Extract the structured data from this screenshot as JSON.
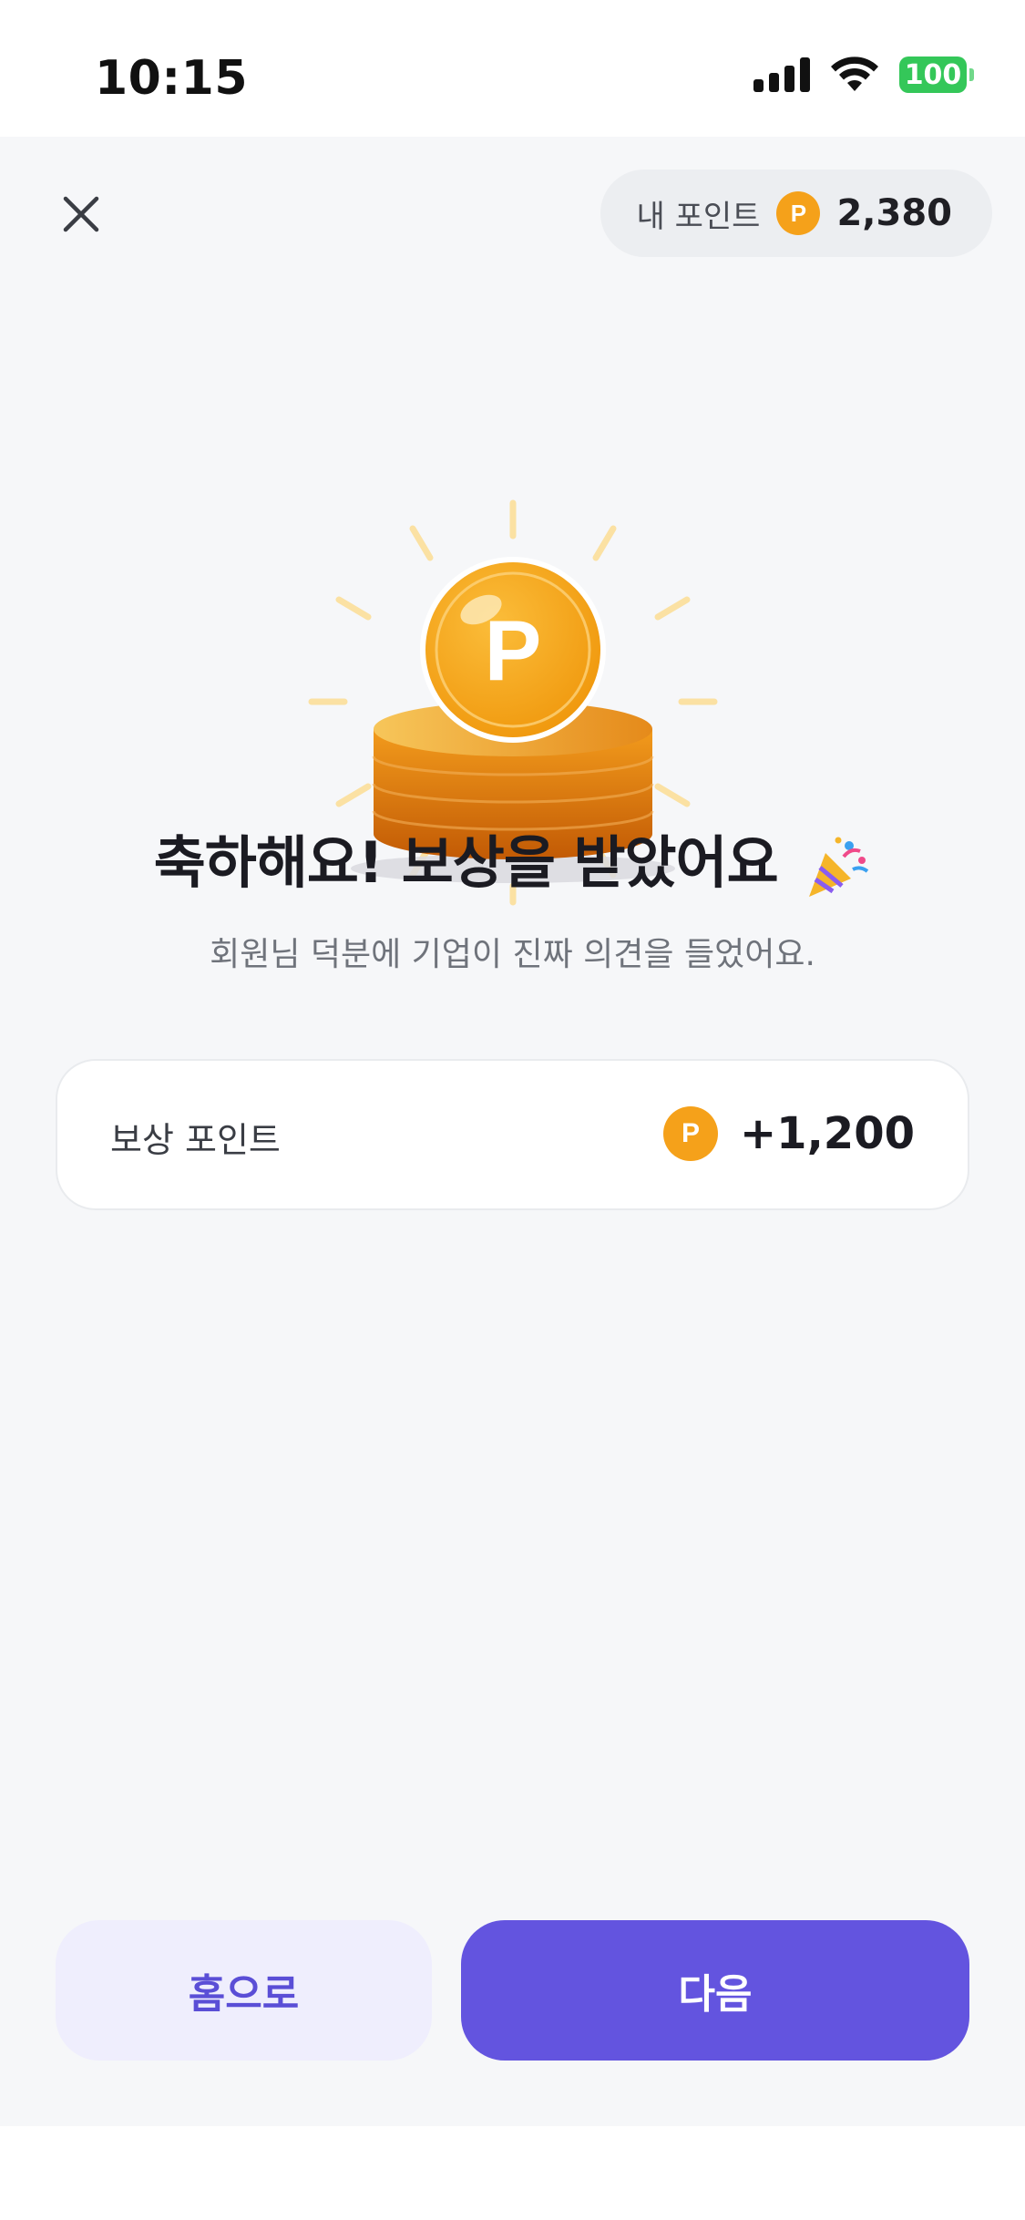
{
  "status_bar": {
    "time": "10:15",
    "battery": "100"
  },
  "header": {
    "points_label": "내 포인트",
    "coin_symbol": "P",
    "points_value": "2,380"
  },
  "hero": {
    "coin_letter": "P"
  },
  "content": {
    "headline": "축하해요! 보상을 받았어요",
    "subtitle": "회원님 덕분에 기업이 진짜 의견을 들었어요."
  },
  "reward": {
    "label": "보상 포인트",
    "coin_symbol": "P",
    "value": "+1,200"
  },
  "buttons": {
    "home_label": "홈으로",
    "next_label": "다음"
  },
  "colors": {
    "accent": "#6354df",
    "accent_soft": "#efeefd",
    "coin": "#f5a11a",
    "battery": "#34c759"
  },
  "icons": {
    "close": "close-icon",
    "coin": "coin-icon",
    "party": "party-popper-icon"
  }
}
